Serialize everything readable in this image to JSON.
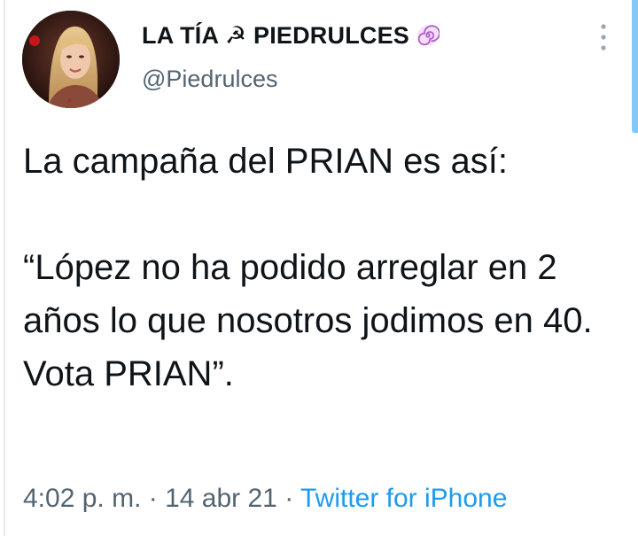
{
  "tweet": {
    "display_name": "LA TÍA ☭ PIEDRULCES",
    "handle": "@Piedrulces",
    "badge_icon": "swirl-icon",
    "text": "La campaña del PRIAN es así:\n\n“López no ha podido arreglar en 2 años lo que nosotros jodimos en 40. Vota PRIAN”.",
    "time": "4:02 p. m.",
    "separator": " · ",
    "date": "14 abr 21",
    "source": "Twitter for iPhone"
  },
  "colors": {
    "text": "#0f1419",
    "secondary": "#536471",
    "link": "#1d9bf0"
  }
}
